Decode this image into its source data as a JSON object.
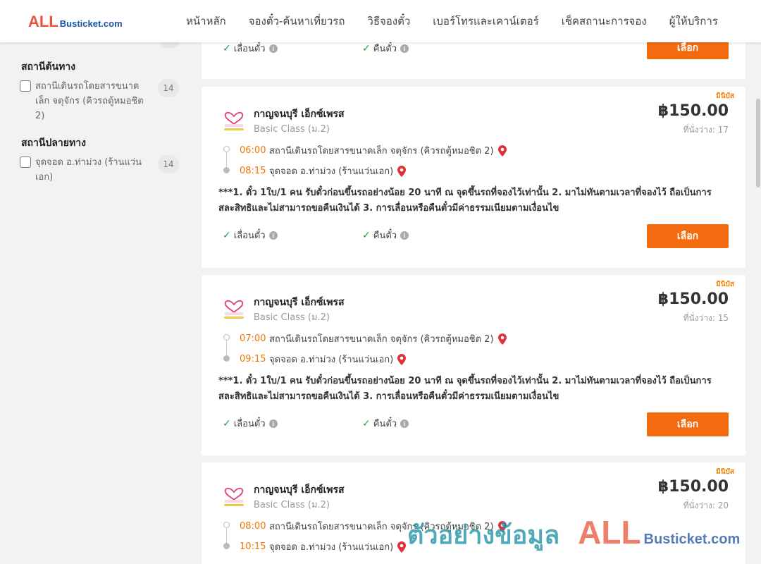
{
  "header": {
    "logo_main": "ALL",
    "logo_rest": "Busticket.com",
    "nav": [
      "หน้าหลัก",
      "จองตั๋ว-ค้นหาเที่ยวรถ",
      "วิธีจองตั๋ว",
      "เบอร์โทรและเคาน์เตอร์",
      "เช็คสถานะการจอง",
      "ผู้ให้บริการ"
    ]
  },
  "sidebar": {
    "origin_title": "สถานีต้นทาง",
    "origin_option": {
      "label": "สถานีเดินรถโดยสารขนาดเล็ก จตุจักร (คิวรถตู้หมอชิต 2)",
      "count": "14",
      "checked": false
    },
    "destination_title": "สถานีปลายทาง",
    "destination_option": {
      "label": "จุดจอด อ.ท่าม่วง (ร้านแว่นเอก)",
      "count": "14",
      "checked": false
    }
  },
  "top_card": {
    "change_label": "เลื่อนตั๋ว",
    "refund_label": "คืนตั๋ว",
    "select_label": "เลือก"
  },
  "cards": [
    {
      "tag": "มินิบัส",
      "operator": "กาญจนบุรี เอ็กซ์เพรส",
      "class": "Basic Class (ม.2)",
      "price": "฿150.00",
      "seats": "ที่นั่งว่าง: 17",
      "depart_time": "06:00",
      "depart_station": "สถานีเดินรถโดยสารขนาดเล็ก จตุจักร (คิวรถตู้หมอชิต 2)",
      "arrive_time": "08:15",
      "arrive_station": "จุดจอด อ.ท่าม่วง (ร้านแว่นเอก)",
      "remark": "***1. ตั๋ว 1ใบ/1 คน รับตั๋วก่อนขึ้นรถอย่างน้อย 20 นาที ณ จุดขึ้นรถที่จองไว้เท่านั้น 2. มาไม่ทันตามเวลาที่จองไว้ ถือเป็นการสละสิทธิและไม่สามารถขอคืนเงินได้ 3. การเลื่อนหรือคืนตั๋วมีค่าธรรมเนียมตามเงื่อนไข",
      "change_label": "เลื่อนตั๋ว",
      "refund_label": "คืนตั๋ว",
      "select_label": "เลือก"
    },
    {
      "tag": "มินิบัส",
      "operator": "กาญจนบุรี เอ็กซ์เพรส",
      "class": "Basic Class (ม.2)",
      "price": "฿150.00",
      "seats": "ที่นั่งว่าง: 15",
      "depart_time": "07:00",
      "depart_station": "สถานีเดินรถโดยสารขนาดเล็ก จตุจักร (คิวรถตู้หมอชิต 2)",
      "arrive_time": "09:15",
      "arrive_station": "จุดจอด อ.ท่าม่วง (ร้านแว่นเอก)",
      "remark": "***1. ตั๋ว 1ใบ/1 คน รับตั๋วก่อนขึ้นรถอย่างน้อย 20 นาที ณ จุดขึ้นรถที่จองไว้เท่านั้น 2. มาไม่ทันตามเวลาที่จองไว้ ถือเป็นการสละสิทธิและไม่สามารถขอคืนเงินได้ 3. การเลื่อนหรือคืนตั๋วมีค่าธรรมเนียมตามเงื่อนไข",
      "change_label": "เลื่อนตั๋ว",
      "refund_label": "คืนตั๋ว",
      "select_label": "เลือก"
    },
    {
      "tag": "มินิบัส",
      "operator": "กาญจนบุรี เอ็กซ์เพรส",
      "class": "Basic Class (ม.2)",
      "price": "฿150.00",
      "seats": "ที่นั่งว่าง: 20",
      "depart_time": "08:00",
      "depart_station": "สถานีเดินรถโดยสารขนาดเล็ก จตุจักร (คิวรถตู้หมอชิต 2)",
      "arrive_time": "10:15",
      "arrive_station": "จุดจอด อ.ท่าม่วง (ร้านแว่นเอก)"
    }
  ],
  "watermark": {
    "text": "ตัวอย่างข้อมูล",
    "logo_main": "ALL",
    "logo_rest": "Busticket.com"
  },
  "colors": {
    "accent": "#f26c0f",
    "time": "#f07800",
    "check": "#2a9a3a",
    "logo_red": "#f0503c",
    "logo_blue": "#1a56a8"
  }
}
